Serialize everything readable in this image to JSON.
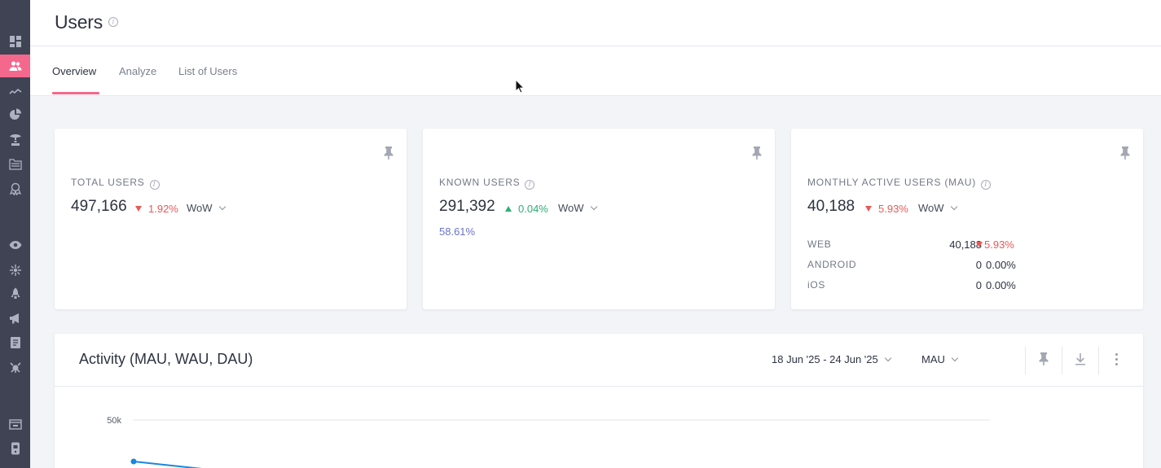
{
  "header": {
    "title": "Users"
  },
  "tabs": [
    {
      "label": "Overview",
      "active": true
    },
    {
      "label": "Analyze",
      "active": false
    },
    {
      "label": "List of Users",
      "active": false
    }
  ],
  "sidebar": {
    "items": [
      {
        "icon": "dashboard-icon",
        "active": false
      },
      {
        "icon": "users-icon",
        "active": true
      },
      {
        "icon": "trends-icon",
        "active": false
      },
      {
        "icon": "pie-chart-icon",
        "active": false
      },
      {
        "icon": "funnel-icon",
        "active": false
      },
      {
        "icon": "folders-icon",
        "active": false
      },
      {
        "icon": "badge-icon",
        "active": false
      },
      {
        "icon": "eye-icon",
        "active": false
      },
      {
        "icon": "sparkle-icon",
        "active": false
      },
      {
        "icon": "rocket-icon",
        "active": false
      },
      {
        "icon": "megaphone-icon",
        "active": false
      },
      {
        "icon": "report-icon",
        "active": false
      },
      {
        "icon": "plug-icon",
        "active": false
      },
      {
        "icon": "inbox-icon",
        "active": false
      },
      {
        "icon": "mobile-icon",
        "active": false
      }
    ]
  },
  "cards": {
    "total": {
      "label": "TOTAL USERS",
      "value": "497,166",
      "delta": "1.92%",
      "delta_direction": "down",
      "period": "WoW"
    },
    "known": {
      "label": "KNOWN USERS",
      "value": "291,392",
      "delta": "0.04%",
      "delta_direction": "up",
      "period": "WoW",
      "percent_of_total": "58.61%"
    },
    "mau": {
      "label": "MONTHLY ACTIVE USERS (MAU)",
      "value": "40,188",
      "delta": "5.93%",
      "delta_direction": "down",
      "period": "WoW",
      "platforms": [
        {
          "name": "WEB",
          "value": "40,188",
          "delta": "5.93%",
          "direction": "down"
        },
        {
          "name": "ANDROID",
          "value": "0",
          "delta": "0.00%",
          "direction": "none"
        },
        {
          "name": "iOS",
          "value": "0",
          "delta": "0.00%",
          "direction": "none"
        }
      ]
    }
  },
  "activity": {
    "title": "Activity (MAU, WAU, DAU)",
    "date_range": "18 Jun '25 - 24 Jun '25",
    "metric": "MAU"
  },
  "chart_data": {
    "type": "line",
    "title": "Activity (MAU, WAU, DAU)",
    "yticks": [
      "50k"
    ],
    "series": [
      {
        "values": [
          40188
        ],
        "color": "#1a86e0"
      }
    ]
  },
  "colors": {
    "accent": "#f4688d",
    "sidebar_bg": "#3f4354",
    "down": "#e85a5a",
    "up": "#2fae74",
    "link": "#6c74c9",
    "line_series": "#1a86e0"
  }
}
